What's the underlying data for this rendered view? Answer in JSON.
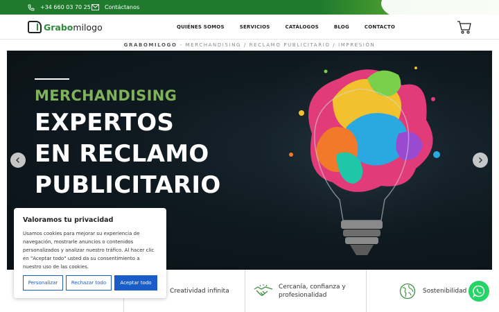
{
  "topbar": {
    "phone": "+34 660 03 70 25",
    "contact": "Contáctanos"
  },
  "logo": {
    "strong": "Grabo",
    "light": "milogo"
  },
  "nav": {
    "items": [
      "QUIÉNES SOMOS",
      "SERVICIOS",
      "CATÁLOGOS",
      "BLOG",
      "CONTACTO"
    ]
  },
  "breadcrumb": {
    "brand": "GRABOMILOGO",
    "rest": "- MERCHANDISING / RECLAMO PUBLICITARIO / IMPRESIÓN"
  },
  "hero": {
    "kicker": "MERCHANDISING",
    "line1": "EXPERTOS",
    "line2": "EN RECLAMO",
    "line3": "PUBLICITARIO"
  },
  "features": {
    "creatividad": "Creatividad infinita",
    "cercania_1": "Cercanía, confianza y",
    "cercania_2": "profesionalidad",
    "sostenibilidad": "Sostenibilidad"
  },
  "cookie": {
    "title": "Valoramos tu privacidad",
    "body": "Usamos cookies para mejorar su experiencia de navegación, mostrarle anuncios o contenidos personalizados y analizar nuestro tráfico. Al hacer clic en \"Aceptar todo\" usted da su consentimiento a nuestro uso de las cookies.",
    "customize": "Personalizar",
    "reject": "Rechazar todo",
    "accept": "Aceptar todo"
  },
  "colors": {
    "green_dark": "#1f7a2d",
    "green_light": "#7fb25a",
    "blue": "#1a5cc8",
    "whatsapp": "#25d366"
  },
  "icons": [
    "phone-icon",
    "mail-icon",
    "cart-icon",
    "arrow-left-icon",
    "arrow-right-icon",
    "handshake-icon",
    "globe-icon",
    "whatsapp-icon"
  ]
}
